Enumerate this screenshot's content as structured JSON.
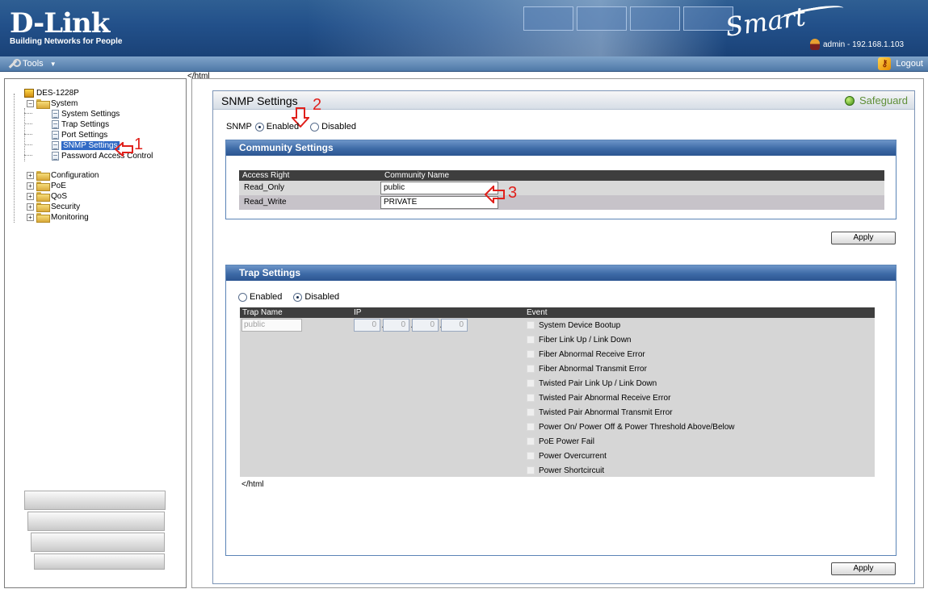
{
  "header": {
    "brand_main": "D-Link",
    "brand_sub": "Building Networks for People",
    "product_logo": "Smart",
    "user": "admin - 192.168.1.103"
  },
  "toolbar": {
    "tools_label": "Tools",
    "logout_label": "Logout"
  },
  "stray_text": "</html",
  "tree": {
    "root": "DES-1228P",
    "system": "System",
    "system_children": [
      "System Settings",
      "Trap Settings",
      "Port Settings",
      "SNMP Settings",
      "Password Access Control"
    ],
    "folders": [
      "Configuration",
      "PoE",
      "QoS",
      "Security",
      "Monitoring"
    ]
  },
  "main": {
    "title": "SNMP Settings",
    "safeguard": "Safeguard",
    "snmp_label": "SNMP",
    "enabled_label": "Enabled",
    "disabled_label": "Disabled",
    "snmp_state": "Enabled"
  },
  "community": {
    "title": "Community Settings",
    "headers": [
      "Access Right",
      "Community Name"
    ],
    "rows": [
      {
        "access": "Read_Only",
        "name": "public"
      },
      {
        "access": "Read_Write",
        "name": "PRIVATE"
      }
    ],
    "apply_label": "Apply"
  },
  "trap": {
    "title": "Trap Settings",
    "enabled_label": "Enabled",
    "disabled_label": "Disabled",
    "state": "Disabled",
    "headers": [
      "Trap Name",
      "IP",
      "Event"
    ],
    "name_value": "public",
    "ip": [
      "0",
      "0",
      "0",
      "0"
    ],
    "events": [
      "System Device Bootup",
      "Fiber Link Up / Link Down",
      "Fiber Abnormal Receive Error",
      "Fiber Abnormal Transmit Error",
      "Twisted Pair Link Up / Link Down",
      "Twisted Pair Abnormal Receive Error",
      "Twisted Pair Abnormal Transmit Error",
      "Power On/ Power Off & Power Threshold Above/Below",
      "PoE Power Fail",
      "Power Overcurrent",
      "Power Shortcircuit"
    ],
    "stray_text": "</html",
    "apply_label": "Apply"
  },
  "annotations": {
    "n1": "1",
    "n2": "2",
    "n3": "3",
    "color": "#e0201b"
  }
}
